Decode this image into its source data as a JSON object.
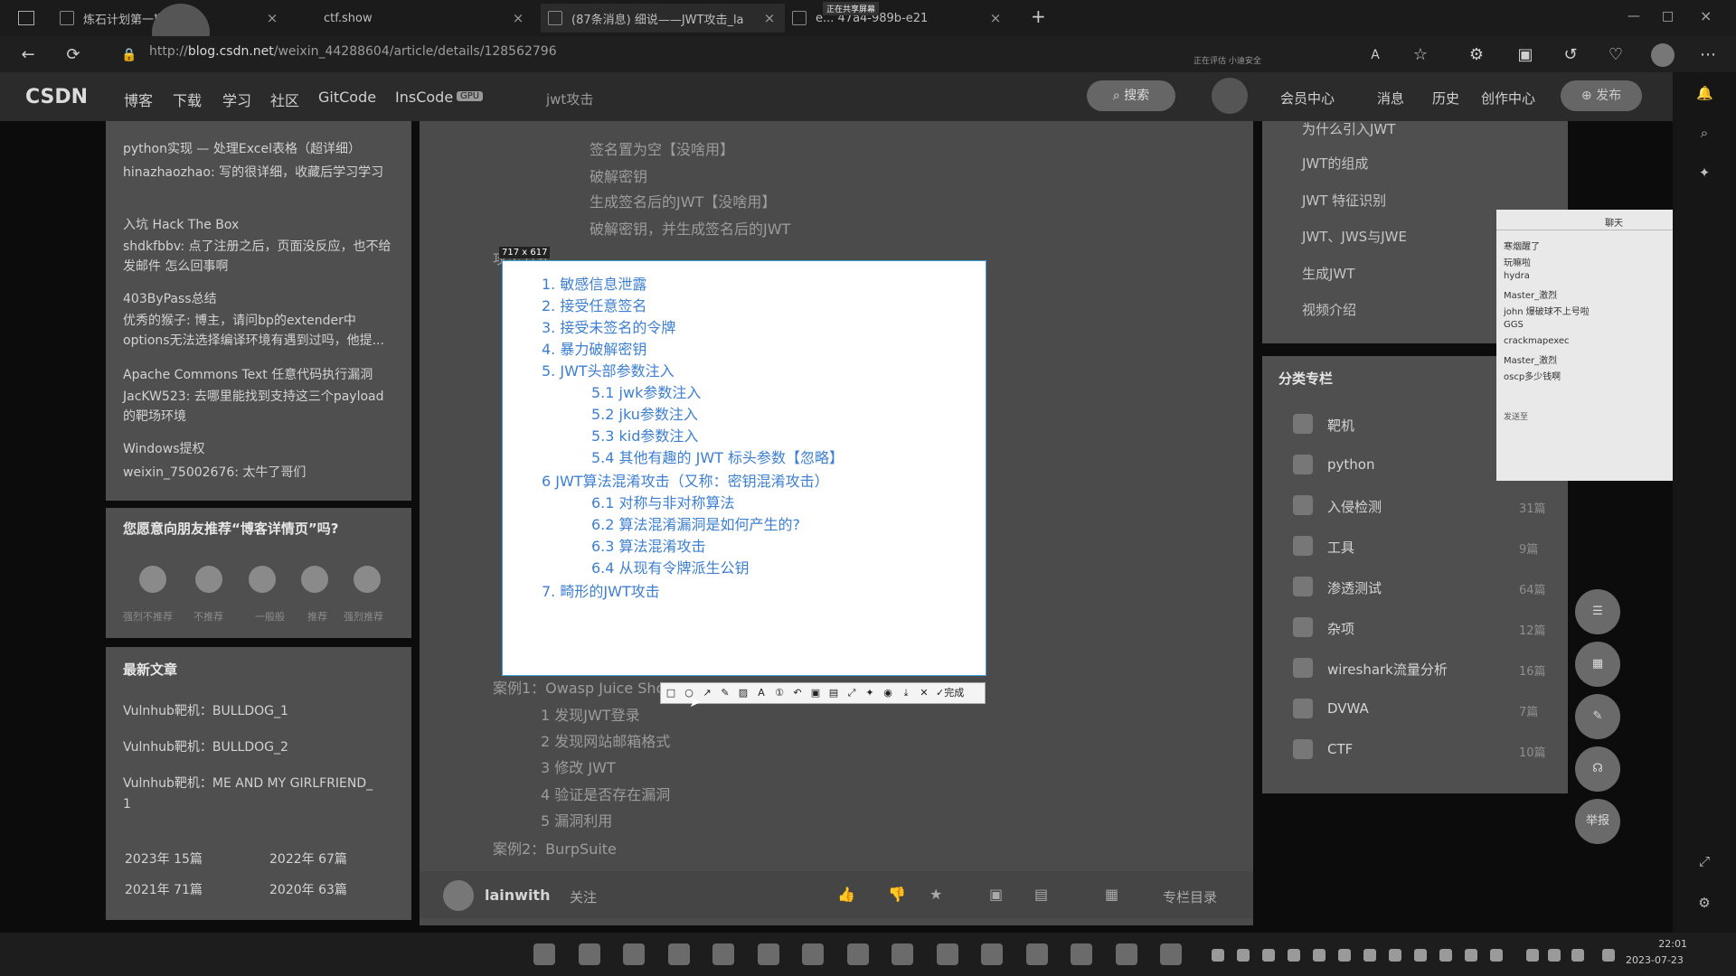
{
  "tabs": [
    {
      "label": "炼石计划第一期"
    },
    {
      "label": "ctf.show"
    },
    {
      "label": "(87条消息) 细说——JWT攻击_la"
    },
    {
      "label": "e... 47a4-989b-e21"
    }
  ],
  "new_tab": "+",
  "address": {
    "prefix": "http",
    "domain": "blog.csdn.net",
    "path": "/weixin_44288604/article/details/128562796",
    "share_note": "正在共享屏幕",
    "badge": "正在评估 小迪安全"
  },
  "csdn": {
    "logo": "CSDN",
    "nav": [
      "博客",
      "下载",
      "学习",
      "社区",
      "GitCode",
      "InsCode"
    ],
    "gpu_badge": "GPU",
    "search_hint": "jwt攻击",
    "search_button": "搜索",
    "right": [
      "会员中心",
      "消息",
      "历史",
      "创作中心"
    ],
    "publish": "发布"
  },
  "left_comments": [
    {
      "title": "python实现 — 处理Excel表格（超详细）",
      "text": "hinazhaozhao: 写的很详细，收藏后学习学习"
    },
    {
      "title": "入坑 Hack The Box",
      "text": "shdkfbbv: 点了注册之后，页面没反应，也不给发邮件 怎么回事啊"
    },
    {
      "title": "403ByPass总结",
      "text": "优秀的猴子: 博主，请问bp的extender中options无法选择编译环境有遇到过吗，他提..."
    },
    {
      "title": "Apache Commons Text 任意代码执行漏洞",
      "text": "JacKW523: 去哪里能找到支持这三个payload的靶场环境"
    },
    {
      "title": "Windows提权",
      "text": "weixin_75002676: 太牛了哥们"
    }
  ],
  "recommend": {
    "question": "您愿意向朋友推荐“博客详情页”吗?",
    "options": [
      "强烈不推荐",
      "不推荐",
      "一般般",
      "推荐",
      "强烈推荐"
    ]
  },
  "latest": {
    "title": "最新文章",
    "items": [
      "Vulnhub靶机：BULLDOG_1",
      "Vulnhub靶机：BULLDOG_2",
      "Vulnhub靶机：ME AND MY GIRLFRIEND_",
      "1"
    ],
    "archive": [
      [
        "2023年",
        "15篇"
      ],
      [
        "2022年",
        "67篇"
      ],
      [
        "2021年",
        "71篇"
      ],
      [
        "2020年",
        "63篇"
      ]
    ]
  },
  "article_bg": {
    "top_lines": [
      "签名置为空【没啥用】",
      "破解密钥",
      "生成签名后的JWT【没啥用】",
      "破解密钥，并生成签名后的JWT"
    ],
    "attack_head": "攻击方式",
    "case1": "案例1：Owasp Juice Shop",
    "case1_steps": [
      "1 发现JWT登录",
      "2 发现网站邮箱格式",
      "3 修改 JWT",
      "4 验证是否存在漏洞",
      "5 漏洞利用"
    ],
    "case2": "案例2：BurpSuite"
  },
  "capture": {
    "size_label": "717 x 617",
    "items": [
      {
        "text": "1. 敏感信息泄露",
        "indent": false
      },
      {
        "text": "2. 接受任意签名",
        "indent": false
      },
      {
        "text": "3. 接受未签名的令牌",
        "indent": false
      },
      {
        "text": "4. 暴力破解密钥",
        "indent": false
      },
      {
        "text": "5. JWT头部参数注入",
        "indent": false
      },
      {
        "text": "5.1 jwk参数注入",
        "indent": true
      },
      {
        "text": "5.2 jku参数注入",
        "indent": true
      },
      {
        "text": "5.3 kid参数注入",
        "indent": true
      },
      {
        "text": "5.4 其他有趣的 JWT 标头参数【忽略】",
        "indent": true
      },
      {
        "text": "6 JWT算法混淆攻击（又称：密钥混淆攻击）",
        "indent": false
      },
      {
        "text": "6.1 对称与非对称算法",
        "indent": true
      },
      {
        "text": "6.2 算法混淆漏洞是如何产生的?",
        "indent": true
      },
      {
        "text": "6.3 算法混淆攻击",
        "indent": true
      },
      {
        "text": "6.4 从现有令牌派生公钥",
        "indent": true
      },
      {
        "text": "7. 畸形的JWT攻击",
        "indent": false
      }
    ],
    "toolbar_done": "完成"
  },
  "footer": {
    "author": "lainwith",
    "follow": "关注",
    "toc": "专栏目录"
  },
  "toc_right": [
    "为什么引入JWT",
    "JWT的组成",
    "JWT 特征识别",
    "JWT、JWS与JWE",
    "生成JWT",
    "视频介绍"
  ],
  "categories": {
    "title": "分类专栏",
    "items": [
      {
        "name": "靶机",
        "count": ""
      },
      {
        "name": "python",
        "count": ""
      },
      {
        "name": "入侵检测",
        "count": "31篇"
      },
      {
        "name": "工具",
        "count": "9篇"
      },
      {
        "name": "渗透测试",
        "count": "64篇"
      },
      {
        "name": "杂项",
        "count": "12篇"
      },
      {
        "name": "wireshark流量分析",
        "count": "16篇"
      },
      {
        "name": "DVWA",
        "count": "7篇"
      },
      {
        "name": "CTF",
        "count": "10篇"
      }
    ]
  },
  "float_buttons": [
    "",
    "",
    "",
    "",
    "举报"
  ],
  "chat_popup": {
    "header": "聊天",
    "lines": [
      "寒烟醒了",
      "玩嘛啦",
      "hydra",
      "Master_激烈",
      "john 爆破球不上号啦",
      "GGS",
      "crackmapexec",
      "Master_激烈",
      "oscp多少钱啊"
    ],
    "send": "发送至"
  },
  "clock": {
    "time": "22:01",
    "date": "2023-07-23"
  }
}
